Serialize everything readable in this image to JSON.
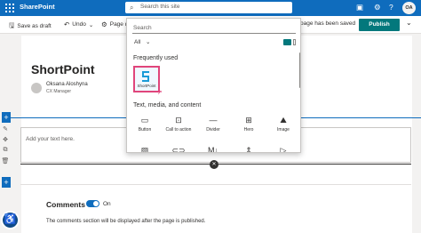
{
  "suite": {
    "title": "SharePoint",
    "search_placeholder": "Search this site",
    "avatar_initials": "OA",
    "icons": [
      "waffle-icon",
      "chat-icon",
      "gear-icon",
      "help-icon"
    ]
  },
  "command_bar": {
    "save_draft": "Save as draft",
    "undo": "Undo",
    "page_details": "Page d",
    "saved_status": "page has been saved",
    "publish": "Publish"
  },
  "page": {
    "title": "ShortPoint",
    "author_name": "Oksana Aloshyna",
    "author_role": "CX Manager",
    "text_placeholder": "Add your text here."
  },
  "comments": {
    "title": "Comments",
    "toggle_label": "On",
    "toggle_on": true,
    "note": "The comments section will be displayed after the page is published."
  },
  "toolbox": {
    "search_placeholder": "Search",
    "filter_value": "All",
    "frequently_used_heading": "Frequently used",
    "frequently_used": [
      {
        "label": "ShortPoint",
        "icon": "shortpoint-logo-icon"
      }
    ],
    "text_media_heading": "Text, media, and content",
    "items": [
      {
        "label": "Button",
        "icon": "button-icon"
      },
      {
        "label": "Call to action",
        "icon": "call-to-action-icon"
      },
      {
        "label": "Divider",
        "icon": "divider-icon"
      },
      {
        "label": "Hero",
        "icon": "hero-icon"
      },
      {
        "label": "Image",
        "icon": "image-icon"
      },
      {
        "label": "",
        "icon": "image-gallery-icon"
      },
      {
        "label": "",
        "icon": "link-icon"
      },
      {
        "label": "",
        "icon": "markdown-icon"
      },
      {
        "label": "",
        "icon": "spacer-icon"
      },
      {
        "label": "",
        "icon": "stream-icon"
      }
    ]
  },
  "colors": {
    "suite_bar": "#0f6cbd",
    "publish": "#03787c",
    "highlight": "#e0457b"
  }
}
